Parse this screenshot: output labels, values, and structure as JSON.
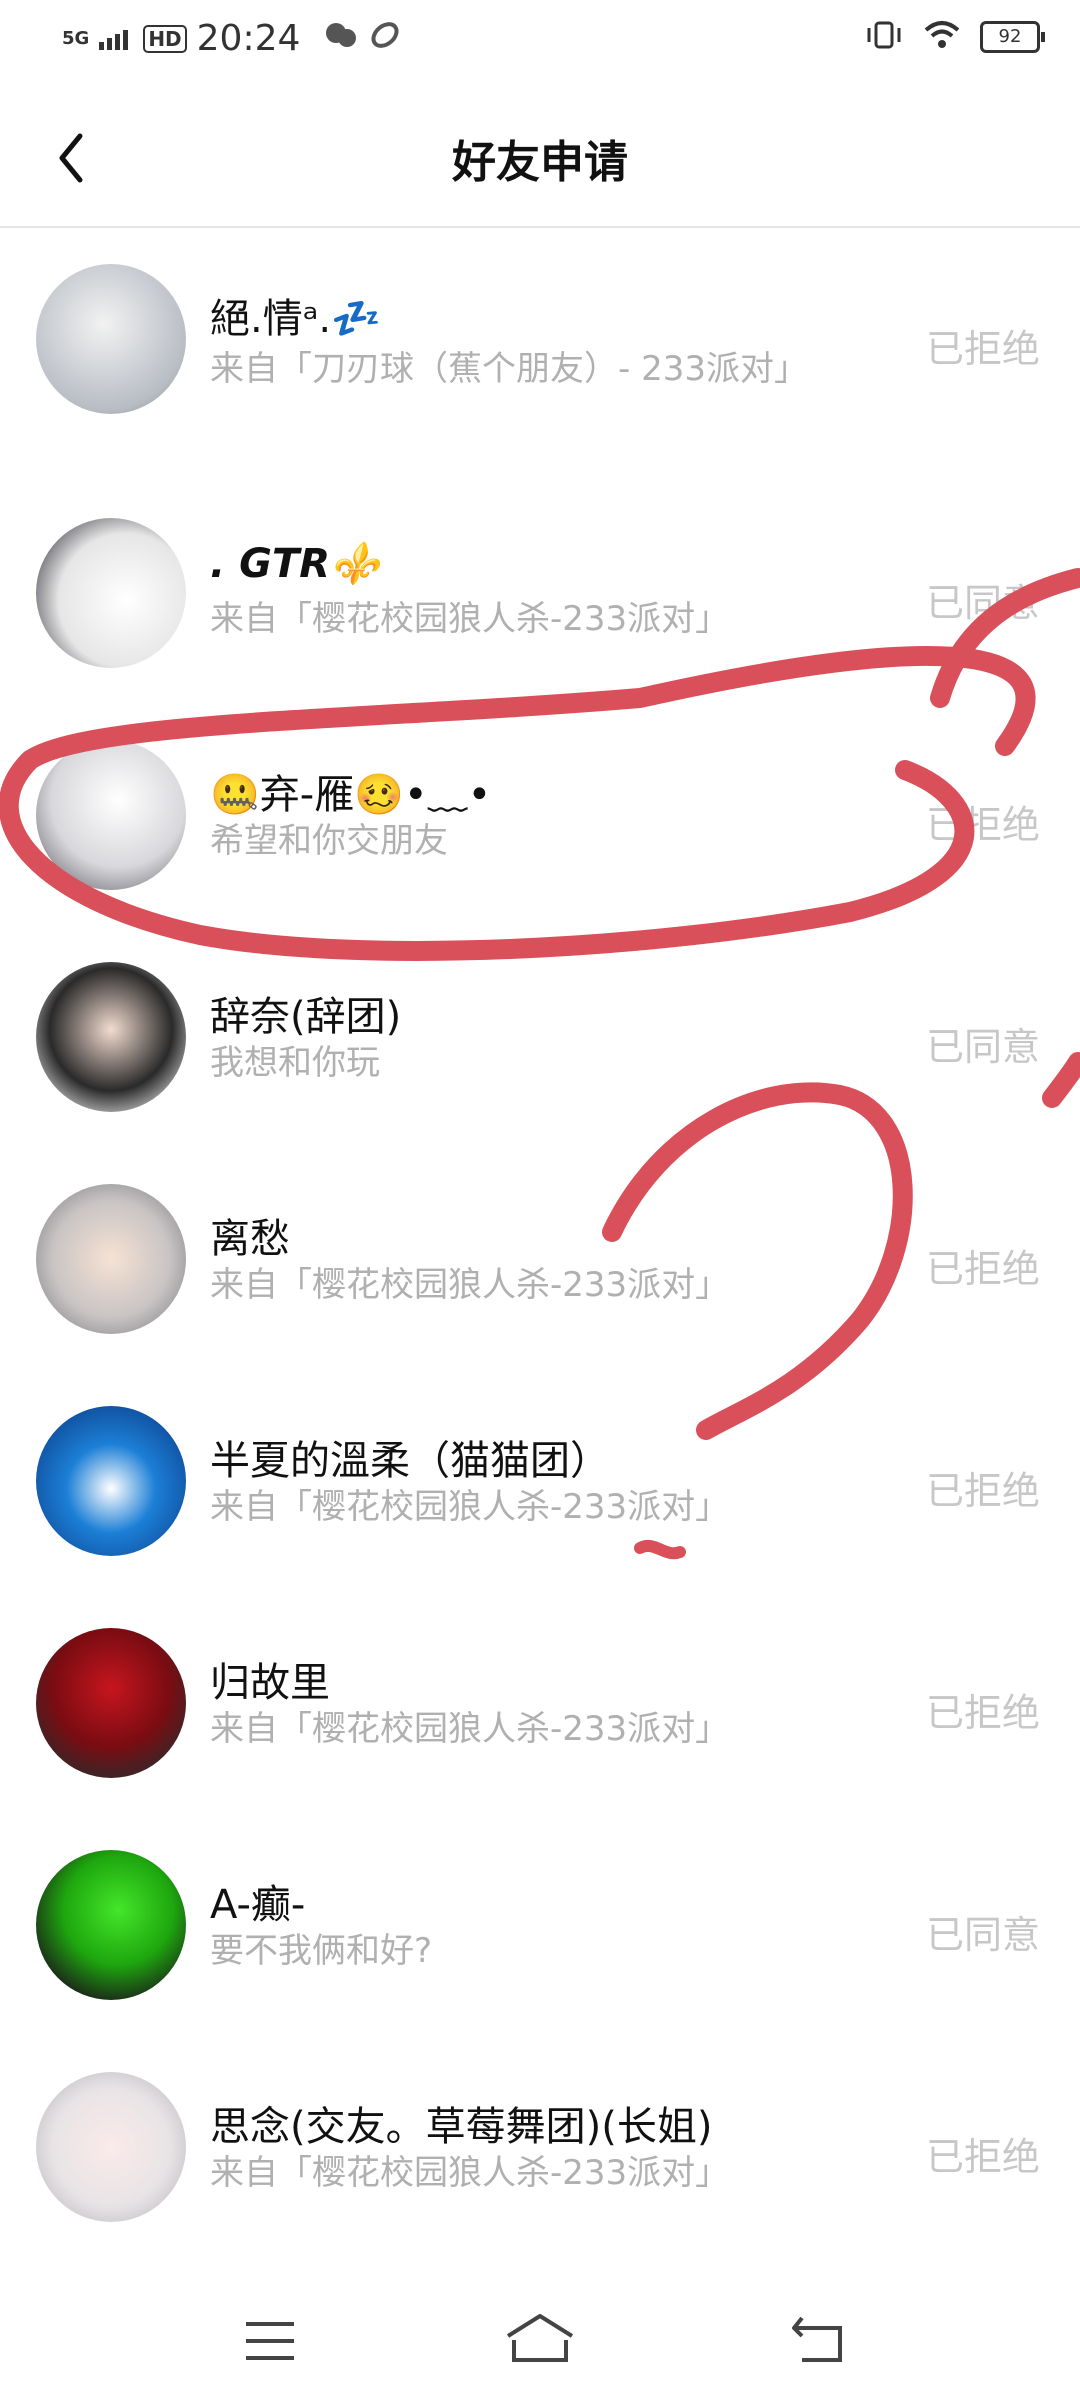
{
  "status_bar": {
    "network": "5G",
    "hd": "HD",
    "time": "20:24",
    "battery": "92"
  },
  "header": {
    "title": "好友申请"
  },
  "requests": [
    {
      "name": "絕.情ᵃ.💤",
      "subtitle": "来自「刀刃球（蕉个朋友）- 233派对」",
      "status": "已拒绝"
    },
    {
      "name": ". 𝙂𝙏𝙍⚜️",
      "subtitle": "来自「樱花校园狼人杀-233派对」",
      "status": "已同意"
    },
    {
      "name": "🤐弃-雁🥴•﹏•",
      "subtitle": "希望和你交朋友",
      "status": "已拒绝"
    },
    {
      "name": "辞奈(辞团)",
      "subtitle": "我想和你玩",
      "status": "已同意"
    },
    {
      "name": "离愁",
      "subtitle": "来自「樱花校园狼人杀-233派对」",
      "status": "已拒绝"
    },
    {
      "name": "半夏的溫柔（猫猫团）",
      "subtitle": "来自「樱花校园狼人杀-233派对」",
      "status": "已拒绝"
    },
    {
      "name": "归故里",
      "subtitle": "来自「樱花校园狼人杀-233派对」",
      "status": "已拒绝"
    },
    {
      "name": "A-癫-",
      "subtitle": "要不我俩和好?",
      "status": "已同意"
    },
    {
      "name": "思念(交友。草莓舞团)(长姐)",
      "subtitle": "来自「樱花校园狼人杀-233派对」",
      "status": "已拒绝"
    }
  ],
  "colors": {
    "annotation": "#d9505a",
    "muted_text": "#b0b0b0"
  }
}
